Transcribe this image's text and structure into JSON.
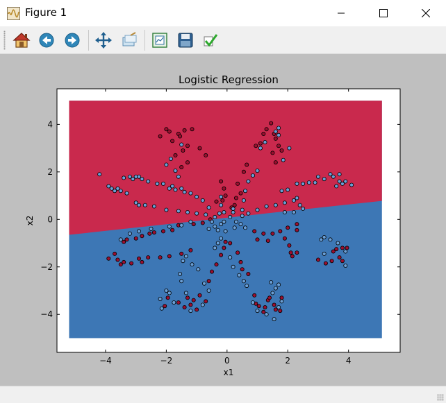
{
  "window": {
    "title": "Figure 1",
    "controls": {
      "minimize": "—",
      "maximize": "☐",
      "close": "✕"
    }
  },
  "toolbar": {
    "buttons": [
      {
        "name": "home",
        "icon": "home-icon"
      },
      {
        "name": "back",
        "icon": "arrow-left-icon"
      },
      {
        "name": "forward",
        "icon": "arrow-right-icon"
      },
      {
        "name": "pan",
        "icon": "move-icon"
      },
      {
        "name": "zoom",
        "icon": "zoom-rect-icon"
      },
      {
        "name": "subplots",
        "icon": "subplots-icon"
      },
      {
        "name": "save",
        "icon": "floppy-icon"
      },
      {
        "name": "edit",
        "icon": "check-icon"
      }
    ]
  },
  "colors": {
    "class0_region": "#c9294d",
    "class1_region": "#3d77b5",
    "point_red": "#9b0f2f",
    "point_blue": "#6a9fd6",
    "point_edge": "#000000",
    "figure_bg": "#bfbfbf"
  },
  "chart_data": {
    "type": "scatter",
    "title": "Logistic Regression",
    "xlabel": "x1",
    "ylabel": "x2",
    "xlim": [
      -5.6,
      5.7
    ],
    "ylim": [
      -5.6,
      5.5
    ],
    "region_xlim": [
      -5.2,
      5.1
    ],
    "region_ylim": [
      -5.0,
      5.0
    ],
    "decision_boundary": {
      "x": [
        -5.2,
        5.1
      ],
      "y": [
        -0.65,
        0.78
      ]
    },
    "xticks": [
      -4,
      -2,
      0,
      2,
      4
    ],
    "yticks": [
      -4,
      -2,
      0,
      2,
      4
    ],
    "xtick_labels": [
      "−4",
      "−2",
      "0",
      "2",
      "4"
    ],
    "ytick_labels": [
      "−4",
      "−2",
      "0",
      "2",
      "4"
    ],
    "series": [
      {
        "points": [
          [
            -2.0,
            3.8
          ],
          [
            -1.9,
            3.7
          ],
          [
            -1.6,
            3.6
          ],
          [
            -1.8,
            3.3
          ],
          [
            -1.55,
            3.5
          ],
          [
            -1.3,
            3.1
          ],
          [
            -1.45,
            2.9
          ],
          [
            -1.7,
            2.7
          ],
          [
            -1.3,
            2.4
          ],
          [
            -1.5,
            2.2
          ],
          [
            -2.2,
            3.5
          ],
          [
            -1.4,
            3.75
          ],
          [
            -1.15,
            3.8
          ],
          [
            -0.9,
            3.0
          ],
          [
            -0.7,
            2.7
          ],
          [
            -0.2,
            1.6
          ],
          [
            -0.1,
            1.3
          ],
          [
            -0.05,
            1.0
          ],
          [
            -0.15,
            0.8
          ],
          [
            -0.35,
            0.75
          ],
          [
            1.3,
            3.8
          ],
          [
            1.55,
            3.6
          ],
          [
            1.45,
            4.05
          ],
          [
            1.6,
            3.4
          ],
          [
            1.7,
            3.1
          ],
          [
            1.5,
            2.8
          ],
          [
            1.6,
            2.4
          ],
          [
            1.2,
            3.6
          ],
          [
            1.1,
            3.2
          ],
          [
            1.8,
            2.9
          ],
          [
            0.95,
            3.1
          ],
          [
            0.65,
            2.3
          ],
          [
            0.55,
            2.0
          ],
          [
            0.35,
            1.5
          ],
          [
            0.45,
            1.1
          ],
          [
            0.25,
            0.6
          ],
          [
            0.3,
            0.9
          ],
          [
            0.15,
            0.5
          ],
          [
            -3.9,
            -1.65
          ],
          [
            -3.6,
            -1.7
          ],
          [
            -3.4,
            -1.8
          ],
          [
            -3.15,
            -1.85
          ],
          [
            -2.8,
            -1.8
          ],
          [
            -2.6,
            -1.6
          ],
          [
            -2.2,
            -1.6
          ],
          [
            -1.9,
            -1.55
          ],
          [
            -1.5,
            -1.45
          ],
          [
            -1.2,
            -1.3
          ],
          [
            -3.7,
            -1.45
          ],
          [
            -3.5,
            -1.9
          ],
          [
            -2.9,
            -1.65
          ],
          [
            -3.3,
            -0.85
          ],
          [
            -3.0,
            -0.8
          ],
          [
            -2.8,
            -0.7
          ],
          [
            -2.55,
            -0.6
          ],
          [
            -2.4,
            -0.55
          ],
          [
            -2.1,
            -0.5
          ],
          [
            -1.8,
            -0.45
          ],
          [
            -3.4,
            -0.95
          ],
          [
            -1.6,
            -0.25
          ],
          [
            -1.1,
            -0.2
          ],
          [
            -0.8,
            -0.15
          ],
          [
            -0.55,
            0.0
          ],
          [
            0.9,
            -0.5
          ],
          [
            1.2,
            -0.6
          ],
          [
            1.5,
            -0.6
          ],
          [
            1.75,
            -0.5
          ],
          [
            2.0,
            -0.35
          ],
          [
            2.3,
            -0.45
          ],
          [
            2.3,
            -0.2
          ],
          [
            1.9,
            -0.8
          ],
          [
            1.35,
            -0.9
          ],
          [
            1.0,
            -0.85
          ],
          [
            2.1,
            -1.4
          ],
          [
            2.3,
            -1.4
          ],
          [
            2.05,
            -1.1
          ],
          [
            2.15,
            -1.55
          ],
          [
            3.0,
            -1.7
          ],
          [
            3.25,
            -1.85
          ],
          [
            3.45,
            -1.75
          ],
          [
            3.5,
            -1.35
          ],
          [
            3.6,
            -1.25
          ],
          [
            3.8,
            -1.2
          ],
          [
            3.95,
            -1.2
          ],
          [
            3.7,
            -1.6
          ],
          [
            3.8,
            -1.75
          ],
          [
            -1.95,
            -3.3
          ],
          [
            -2.05,
            -3.65
          ],
          [
            -1.6,
            -3.5
          ],
          [
            -1.4,
            -3.7
          ],
          [
            -1.2,
            -3.6
          ],
          [
            -1.0,
            -3.8
          ],
          [
            -0.7,
            -3.45
          ],
          [
            -0.9,
            -3.2
          ],
          [
            -1.3,
            -3.3
          ],
          [
            -1.1,
            -3.4
          ],
          [
            -0.6,
            -2.6
          ],
          [
            -0.5,
            -2.2
          ],
          [
            -0.35,
            -1.9
          ],
          [
            -0.2,
            -1.5
          ],
          [
            -0.1,
            -1.2
          ],
          [
            -0.05,
            -0.95
          ],
          [
            0.95,
            -3.55
          ],
          [
            1.05,
            -3.65
          ],
          [
            1.25,
            -3.7
          ],
          [
            1.35,
            -3.4
          ],
          [
            1.2,
            -3.9
          ],
          [
            1.6,
            -3.8
          ],
          [
            1.55,
            -3.6
          ],
          [
            1.75,
            -3.85
          ],
          [
            0.9,
            -3.2
          ],
          [
            1.4,
            -3.3
          ],
          [
            1.8,
            -3.3
          ],
          [
            0.7,
            -2.3
          ],
          [
            0.5,
            -2.1
          ],
          [
            0.45,
            -1.8
          ],
          [
            0.35,
            -1.4
          ],
          [
            0.1,
            -1.0
          ]
        ]
      },
      {
        "points": [
          [
            -4.2,
            1.9
          ],
          [
            -3.9,
            1.4
          ],
          [
            -3.8,
            1.3
          ],
          [
            -3.6,
            1.3
          ],
          [
            -3.5,
            1.2
          ],
          [
            -3.4,
            1.75
          ],
          [
            -3.2,
            1.8
          ],
          [
            -3.0,
            1.8
          ],
          [
            -2.9,
            1.8
          ],
          [
            -2.6,
            1.6
          ],
          [
            -2.3,
            1.5
          ],
          [
            -2.1,
            1.5
          ],
          [
            -1.8,
            1.4
          ],
          [
            -1.7,
            1.25
          ],
          [
            -1.5,
            1.3
          ],
          [
            -1.4,
            1.15
          ],
          [
            -1.2,
            1.1
          ],
          [
            -1.0,
            0.95
          ],
          [
            -0.8,
            0.8
          ],
          [
            -0.6,
            0.5
          ],
          [
            -2.9,
            0.6
          ],
          [
            -2.7,
            0.6
          ],
          [
            -2.4,
            0.55
          ],
          [
            -2.0,
            0.4
          ],
          [
            -1.6,
            0.35
          ],
          [
            -1.3,
            0.3
          ],
          [
            -1.0,
            0.25
          ],
          [
            -0.7,
            0.2
          ],
          [
            -0.4,
            0.1
          ],
          [
            -3.0,
            0.7
          ],
          [
            -3.3,
            1.1
          ],
          [
            -3.7,
            1.2
          ],
          [
            -3.1,
            1.7
          ],
          [
            -2.8,
            1.7
          ],
          [
            -1.9,
            1.3
          ],
          [
            0.5,
            0.15
          ],
          [
            0.7,
            0.25
          ],
          [
            1.0,
            0.4
          ],
          [
            1.3,
            0.55
          ],
          [
            1.6,
            0.6
          ],
          [
            1.9,
            0.7
          ],
          [
            2.2,
            0.8
          ],
          [
            2.4,
            0.6
          ],
          [
            2.5,
            0.45
          ],
          [
            2.3,
            0.9
          ],
          [
            1.8,
            1.2
          ],
          [
            2.0,
            1.25
          ],
          [
            2.3,
            1.5
          ],
          [
            2.5,
            1.5
          ],
          [
            2.7,
            1.55
          ],
          [
            3.0,
            1.8
          ],
          [
            3.2,
            1.7
          ],
          [
            3.5,
            1.8
          ],
          [
            3.7,
            1.9
          ],
          [
            3.8,
            1.5
          ],
          [
            3.9,
            1.6
          ],
          [
            4.1,
            1.45
          ],
          [
            3.7,
            1.6
          ],
          [
            3.6,
            1.4
          ],
          [
            3.4,
            1.9
          ],
          [
            2.9,
            1.55
          ],
          [
            1.9,
            0.3
          ],
          [
            2.2,
            0.3
          ],
          [
            -3.2,
            -0.6
          ],
          [
            -3.5,
            -0.85
          ],
          [
            -2.9,
            -0.5
          ],
          [
            -2.5,
            -0.4
          ],
          [
            -1.9,
            -0.3
          ],
          [
            -1.5,
            -0.25
          ],
          [
            -1.2,
            -0.1
          ],
          [
            -0.6,
            -0.4
          ],
          [
            -0.4,
            -0.3
          ],
          [
            -0.3,
            -0.45
          ],
          [
            -0.2,
            -0.2
          ],
          [
            -0.1,
            -0.1
          ],
          [
            -0.25,
            0.25
          ],
          [
            -0.5,
            -0.1
          ],
          [
            0.3,
            -0.1
          ],
          [
            0.45,
            -0.2
          ],
          [
            0.6,
            -0.35
          ],
          [
            3.2,
            -0.75
          ],
          [
            3.1,
            -0.85
          ],
          [
            3.4,
            -0.85
          ],
          [
            3.65,
            -1.0
          ],
          [
            3.9,
            -1.35
          ],
          [
            3.2,
            -1.45
          ],
          [
            3.9,
            -1.95
          ],
          [
            -1.35,
            -3.1
          ],
          [
            -1.5,
            -2.6
          ],
          [
            -1.55,
            -2.3
          ],
          [
            -1.45,
            -1.75
          ],
          [
            -1.35,
            -1.55
          ],
          [
            -1.15,
            -1.9
          ],
          [
            -0.95,
            -2.1
          ],
          [
            -0.75,
            -2.7
          ],
          [
            -0.6,
            -3.0
          ],
          [
            -0.8,
            -3.6
          ],
          [
            -1.2,
            -3.85
          ],
          [
            -1.75,
            -3.5
          ],
          [
            -1.9,
            -3.1
          ],
          [
            -2.2,
            -3.35
          ],
          [
            -2.15,
            -3.75
          ],
          [
            -2.0,
            -3.0
          ],
          [
            -0.3,
            -1.0
          ],
          [
            -0.05,
            -0.5
          ],
          [
            -0.2,
            -0.8
          ],
          [
            -0.4,
            -1.2
          ],
          [
            0.1,
            -1.6
          ],
          [
            0.2,
            -2.0
          ],
          [
            0.4,
            -2.35
          ],
          [
            0.55,
            -2.6
          ],
          [
            0.65,
            -2.8
          ],
          [
            0.85,
            -3.5
          ],
          [
            1.0,
            -3.85
          ],
          [
            1.3,
            -4.0
          ],
          [
            1.55,
            -4.2
          ],
          [
            1.7,
            -3.7
          ],
          [
            1.8,
            -3.45
          ],
          [
            1.5,
            -3.1
          ],
          [
            1.6,
            -2.9
          ],
          [
            1.7,
            -2.75
          ],
          [
            1.45,
            -2.65
          ],
          [
            0.25,
            -0.35
          ],
          [
            -0.2,
            0.6
          ],
          [
            -0.1,
            0.3
          ],
          [
            0.1,
            0.1
          ],
          [
            0.2,
            0.3
          ],
          [
            0.5,
            0.4
          ],
          [
            0.55,
            0.8
          ],
          [
            0.2,
            0.45
          ],
          [
            1.25,
            3.25
          ],
          [
            1.1,
            3.0
          ],
          [
            1.6,
            3.7
          ],
          [
            1.7,
            3.85
          ],
          [
            -1.5,
            3.15
          ],
          [
            -1.85,
            2.55
          ],
          [
            -2.0,
            2.3
          ],
          [
            -1.7,
            2.05
          ],
          [
            -1.6,
            1.8
          ],
          [
            1.85,
            2.5
          ],
          [
            2.05,
            3.0
          ],
          [
            1.7,
            3.55
          ],
          [
            -0.2,
            0.95
          ],
          [
            0.6,
            1.2
          ],
          [
            0.7,
            1.6
          ],
          [
            0.85,
            1.85
          ],
          [
            1.0,
            2.05
          ]
        ]
      }
    ]
  }
}
